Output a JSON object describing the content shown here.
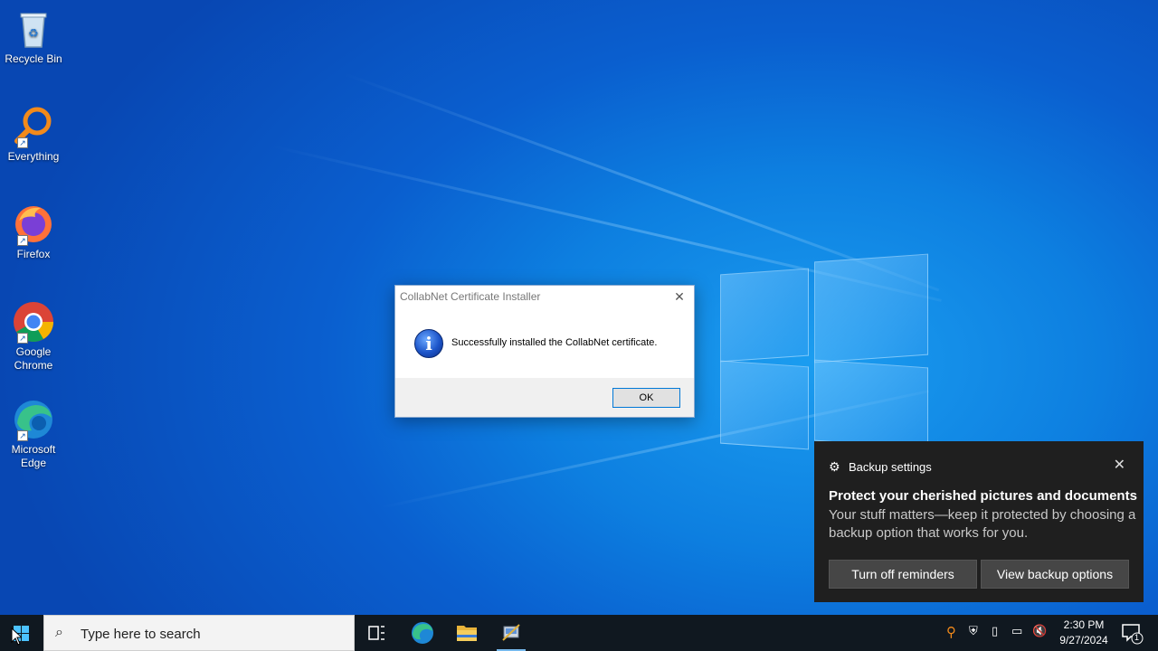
{
  "desktop": {
    "icons": [
      {
        "label": "Recycle Bin",
        "icon": "recycle-bin-icon"
      },
      {
        "label": "Everything",
        "icon": "everything-search-icon"
      },
      {
        "label": "Firefox",
        "icon": "firefox-icon"
      },
      {
        "label": "Google Chrome",
        "icon": "chrome-icon"
      },
      {
        "label": "Microsoft Edge",
        "icon": "edge-icon"
      }
    ]
  },
  "dialog": {
    "title": "CollabNet Certificate Installer",
    "message": "Successfully installed the CollabNet certificate.",
    "ok_label": "OK",
    "close_glyph": "✕",
    "icon": "info-icon"
  },
  "notification": {
    "app_name": "Backup settings",
    "heading": "Protect your cherished pictures and documents",
    "body": "Your stuff matters—keep it protected by choosing a backup option that works for you.",
    "button_1": "Turn off reminders",
    "button_2": "View backup options",
    "close_glyph": "✕"
  },
  "taskbar": {
    "search_placeholder": "Type here to search",
    "pinned": [
      "task-view-icon",
      "edge-icon",
      "file-explorer-icon",
      "certificate-installer-icon"
    ],
    "tray": [
      "everything-icon",
      "security-icon",
      "usb-icon",
      "network-icon",
      "volume-muted-icon"
    ],
    "time": "2:30 PM",
    "date": "9/27/2024",
    "notification_count": "1"
  },
  "colors": {
    "accent": "#0078d7",
    "taskbar": "#101820",
    "toast_bg": "#1f1f1f"
  }
}
